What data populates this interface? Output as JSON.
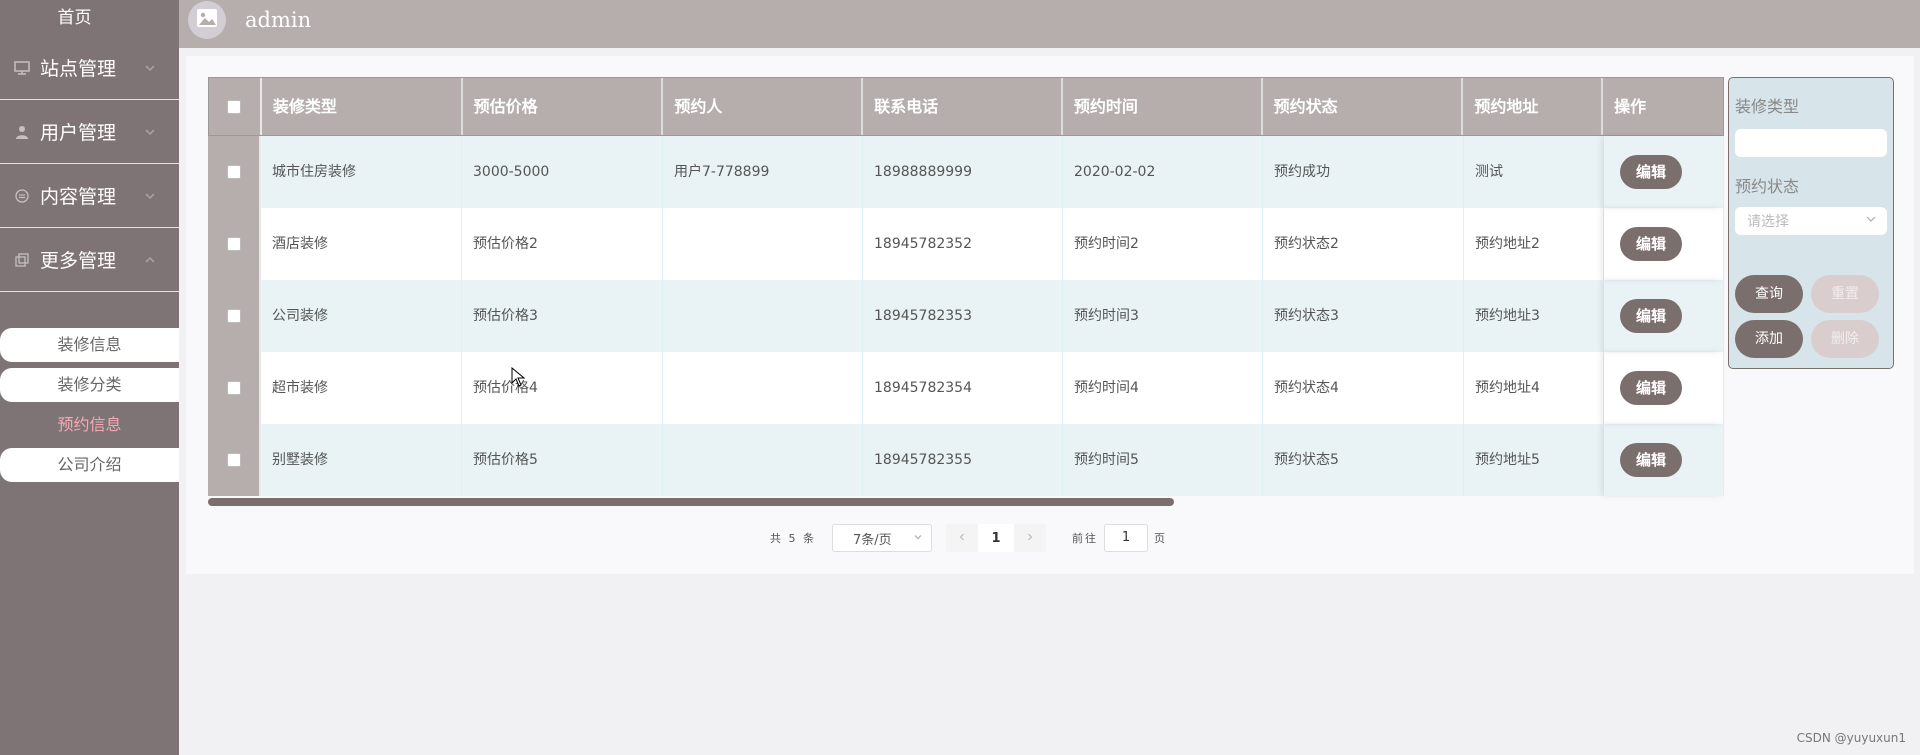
{
  "sidebar": {
    "home": "首页",
    "groups": [
      {
        "label": "站点管理",
        "icon": "monitor-icon"
      },
      {
        "label": "用户管理",
        "icon": "user-icon"
      },
      {
        "label": "内容管理",
        "icon": "content-icon"
      },
      {
        "label": "更多管理",
        "icon": "copy-icon"
      }
    ],
    "subitems": [
      {
        "label": "装修信息",
        "style": "white"
      },
      {
        "label": "装修分类",
        "style": "white"
      },
      {
        "label": "预约信息",
        "style": "active"
      },
      {
        "label": "公司介绍",
        "style": "white"
      }
    ]
  },
  "header": {
    "username": "admin"
  },
  "table": {
    "columns": [
      "装修类型",
      "预估价格",
      "预约人",
      "联系电话",
      "预约时间",
      "预约状态",
      "预约地址",
      "操作"
    ],
    "edit_label": "编辑",
    "rows": [
      [
        "城市住房装修",
        "3000-5000",
        "用户7-778899",
        "18988889999",
        "2020-02-02",
        "预约成功",
        "测试"
      ],
      [
        "酒店装修",
        "预估价格2",
        "",
        "18945782352",
        "预约时间2",
        "预约状态2",
        "预约地址2"
      ],
      [
        "公司装修",
        "预估价格3",
        "",
        "18945782353",
        "预约时间3",
        "预约状态3",
        "预约地址3"
      ],
      [
        "超市装修",
        "预估价格4",
        "",
        "18945782354",
        "预约时间4",
        "预约状态4",
        "预约地址4"
      ],
      [
        "别墅装修",
        "预估价格5",
        "",
        "18945782355",
        "预约时间5",
        "预约状态5",
        "预约地址5"
      ]
    ]
  },
  "pagination": {
    "total": "共 5 条",
    "page_size": "7条/页",
    "current_page": "1",
    "goto_prefix": "前往",
    "goto_value": "1",
    "goto_suffix": "页"
  },
  "filter": {
    "type_label": "装修类型",
    "type_value": "",
    "status_label": "预约状态",
    "status_placeholder": "请选择",
    "query": "查询",
    "reset": "重置",
    "add": "添加",
    "delete": "删除"
  },
  "watermark": "CSDN @yuyuxun1",
  "colors": {
    "sidebar": "#7f7475",
    "header": "#b6adad",
    "button": "#7b6f6d",
    "active_menu": "#f4a9b5",
    "filter_panel": "#d7e5ea"
  }
}
